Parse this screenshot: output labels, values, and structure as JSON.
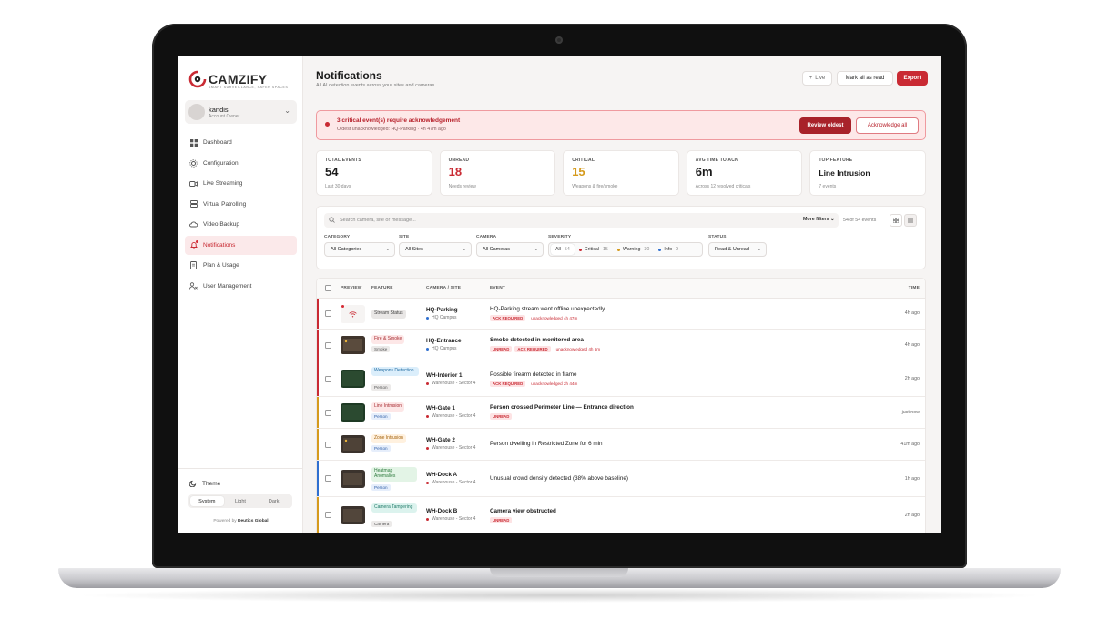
{
  "brand": {
    "name": "CAMZIFY",
    "tagline": "SMART SURVEILLANCE, SAFER SPACES",
    "accent": "#c92a33"
  },
  "user": {
    "name": "kandis",
    "role": "Account Owner"
  },
  "sidebar": {
    "items": [
      {
        "label": "Dashboard",
        "icon": "grid-icon"
      },
      {
        "label": "Configuration",
        "icon": "gear-icon"
      },
      {
        "label": "Live Streaming",
        "icon": "video-icon"
      },
      {
        "label": "Virtual Patrolling",
        "icon": "server-icon"
      },
      {
        "label": "Video Backup",
        "icon": "cloud-icon"
      },
      {
        "label": "Notifications",
        "icon": "bell-icon",
        "active": true
      },
      {
        "label": "Plan & Usage",
        "icon": "document-icon"
      },
      {
        "label": "User Management",
        "icon": "users-icon"
      }
    ],
    "theme": {
      "label": "Theme",
      "options": [
        "System",
        "Light",
        "Dark"
      ],
      "selected": "System"
    },
    "powered_prefix": "Powered by",
    "powered_by": "Deutics Global"
  },
  "header": {
    "title": "Notifications",
    "subtitle": "All AI detection events across your sites and cameras",
    "live_label": "Live",
    "mark_all_label": "Mark all as read",
    "export_label": "Export"
  },
  "alert": {
    "title": "3 critical event(s) require acknowledgement",
    "subtitle": "Oldest unacknowledged: HQ-Parking · 4h 47m ago",
    "review_label": "Review oldest",
    "ack_label": "Acknowledge all"
  },
  "kpis": [
    {
      "label": "TOTAL EVENTS",
      "value": "54",
      "note": "Last 30 days"
    },
    {
      "label": "UNREAD",
      "value": "18",
      "note": "Needs review"
    },
    {
      "label": "CRITICAL",
      "value": "15",
      "note": "Weapons & fire/smoke"
    },
    {
      "label": "AVG TIME TO ACK",
      "value": "6m",
      "note": "Across 12 resolved criticals"
    },
    {
      "label": "TOP FEATURE",
      "value": "Line Intrusion",
      "note": "7 events"
    }
  ],
  "filters": {
    "search_placeholder": "Search camera, site or message...",
    "more_filters": "More filters",
    "count": "54 of 54 events",
    "category": {
      "label": "CATEGORY",
      "value": "All Categories"
    },
    "site": {
      "label": "SITE",
      "value": "All Sites"
    },
    "camera": {
      "label": "CAMERA",
      "value": "All Cameras"
    },
    "severity": {
      "label": "SEVERITY",
      "options": [
        {
          "label": "All",
          "count": "54",
          "color": ""
        },
        {
          "label": "Critical",
          "count": "15",
          "color": "#c92a33"
        },
        {
          "label": "Warning",
          "count": "30",
          "color": "#d59a1c"
        },
        {
          "label": "Info",
          "count": "9",
          "color": "#2f6fd0"
        }
      ]
    },
    "status": {
      "label": "STATUS",
      "value": "Read & Unread"
    }
  },
  "table": {
    "headers": {
      "preview": "PREVIEW",
      "feature": "FEATURE",
      "camera": "CAMERA / SITE",
      "event": "EVENT",
      "time": "TIME"
    },
    "rows": [
      {
        "feature": "Stream Status",
        "feature_sub": "",
        "camera": "HQ-Parking",
        "site": "HQ Campus",
        "message": "HQ-Parking stream went offline unexpectedly",
        "tags": [
          "ACK REQUIRED"
        ],
        "note": "unacknowledged 4h 47m",
        "time": "4h ago",
        "bold": false
      },
      {
        "feature": "Fire & Smoke",
        "feature_sub": "Smoke",
        "camera": "HQ-Entrance",
        "site": "HQ Campus",
        "message": "Smoke detected in monitored area",
        "tags": [
          "UNREAD",
          "ACK REQUIRED"
        ],
        "note": "unacknowledged 4h 6m",
        "time": "4h ago",
        "bold": true
      },
      {
        "feature": "Weapons Detection",
        "feature_sub": "Person",
        "camera": "WH-Interior 1",
        "site": "Warehouse - Sector 4",
        "message": "Possible firearm detected in frame",
        "tags": [
          "ACK REQUIRED"
        ],
        "note": "unacknowledged 2h 44m",
        "time": "2h ago",
        "bold": false
      },
      {
        "feature": "Line Intrusion",
        "feature_sub": "Person",
        "camera": "WH-Gate 1",
        "site": "Warehouse - Sector 4",
        "message": "Person crossed Perimeter Line — Entrance direction",
        "tags": [
          "UNREAD"
        ],
        "note": "",
        "time": "just now",
        "bold": true
      },
      {
        "feature": "Zone Intrusion",
        "feature_sub": "Person",
        "camera": "WH-Gate 2",
        "site": "Warehouse - Sector 4",
        "message": "Person dwelling in Restricted Zone for 6 min",
        "tags": [],
        "note": "",
        "time": "41m ago",
        "bold": false
      },
      {
        "feature": "Heatmap Anomalies",
        "feature_sub": "Person",
        "camera": "WH-Dock A",
        "site": "Warehouse - Sector 4",
        "message": "Unusual crowd density detected (38% above baseline)",
        "tags": [],
        "note": "",
        "time": "1h ago",
        "bold": false
      },
      {
        "feature": "Camera Tampering",
        "feature_sub": "Camera",
        "camera": "WH-Dock B",
        "site": "Warehouse - Sector 4",
        "message": "Camera view obstructed",
        "tags": [
          "UNREAD"
        ],
        "note": "",
        "time": "2h ago",
        "bold": true
      }
    ]
  }
}
